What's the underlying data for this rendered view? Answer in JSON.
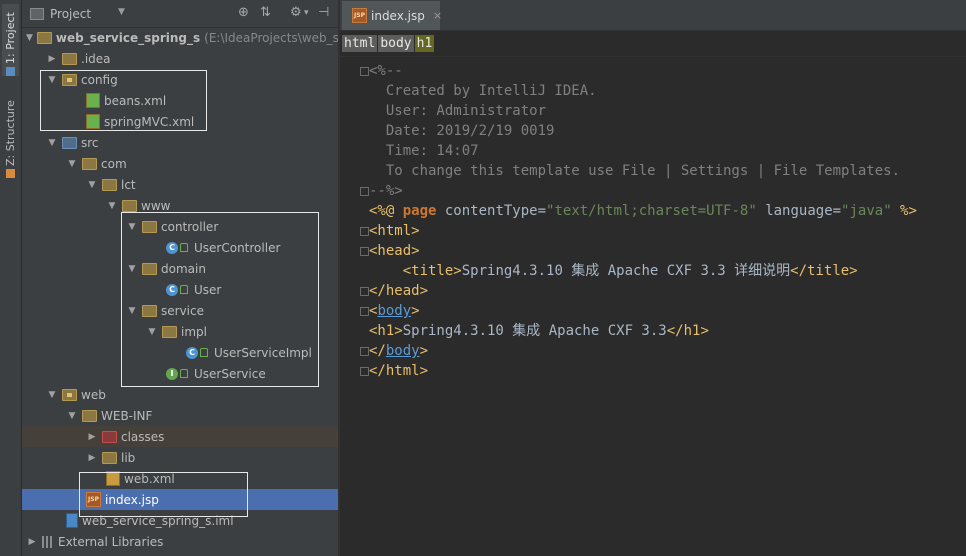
{
  "sidebar_tabs": [
    {
      "label": "1: Project"
    },
    {
      "label": "Z: Structure"
    }
  ],
  "project_panel": {
    "title": "Project",
    "toolbar_icons": [
      "locate-icon",
      "collapse-icon",
      "gear-icon",
      "hide-panel-icon"
    ],
    "tree": [
      {
        "label": "web_service_spring_s",
        "hint": "(E:\\IdeaProjects\\web_ser",
        "icon": "module-folder-icon",
        "expanded": true,
        "bold": true
      },
      {
        "label": ".idea",
        "icon": "folder-icon",
        "expanded": false
      },
      {
        "label": "config",
        "icon": "resources-folder-icon",
        "expanded": true
      },
      {
        "label": "beans.xml",
        "icon": "spring-xml-icon"
      },
      {
        "label": "springMVC.xml",
        "icon": "spring-xml-icon"
      },
      {
        "label": "src",
        "icon": "source-folder-icon",
        "expanded": true
      },
      {
        "label": "com",
        "icon": "package-icon",
        "expanded": true
      },
      {
        "label": "lct",
        "icon": "package-icon",
        "expanded": true
      },
      {
        "label": "www",
        "icon": "package-icon",
        "expanded": true
      },
      {
        "label": "controller",
        "icon": "package-icon",
        "expanded": true
      },
      {
        "label": "UserController",
        "icon": "class-icon"
      },
      {
        "label": "domain",
        "icon": "package-icon",
        "expanded": true
      },
      {
        "label": "User",
        "icon": "class-icon"
      },
      {
        "label": "service",
        "icon": "package-icon",
        "expanded": true
      },
      {
        "label": "impl",
        "icon": "package-icon",
        "expanded": true
      },
      {
        "label": "UserServiceImpl",
        "icon": "class-icon"
      },
      {
        "label": "UserService",
        "icon": "interface-icon"
      },
      {
        "label": "web",
        "icon": "web-folder-icon",
        "expanded": true
      },
      {
        "label": "WEB-INF",
        "icon": "folder-icon",
        "expanded": true
      },
      {
        "label": "classes",
        "icon": "excluded-folder-icon",
        "expanded": false
      },
      {
        "label": "lib",
        "icon": "folder-icon",
        "expanded": false
      },
      {
        "label": "web.xml",
        "icon": "xml-icon"
      },
      {
        "label": "index.jsp",
        "icon": "jsp-icon",
        "selected": true
      },
      {
        "label": "web_service_spring_s.iml",
        "icon": "iml-icon"
      },
      {
        "label": "External Libraries",
        "icon": "libraries-icon",
        "expanded": false
      }
    ]
  },
  "editor": {
    "tab": {
      "label": "index.jsp",
      "close": "×"
    },
    "breadcrumbs": [
      "html",
      "body",
      "h1"
    ],
    "code_lines": [
      "<%--",
      "  Created by IntelliJ IDEA.",
      "  User: Administrator",
      "  Date: 2019/2/19 0019",
      "  Time: 14:07",
      "  To change this template use File | Settings | File Templates.",
      "--%>",
      "<%@ page contentType=\"text/html;charset=UTF-8\" language=\"java\" %>",
      "<html>",
      "<head>",
      "    <title>Spring4.3.10 集成 Apache CXF 3.3 详细说明</title>",
      "</head>",
      "<body>",
      "<h1>Spring4.3.10 集成 Apache CXF 3.3</h1>",
      "</body>",
      "</html>"
    ]
  },
  "colors": {
    "background": "#2b2b2b",
    "panel": "#3c3f41",
    "selection": "#4b6eaf",
    "tag": "#e8bf6a",
    "keyword": "#cc7832",
    "string": "#6a8759",
    "comment": "#808080",
    "text": "#a9b7c6"
  }
}
